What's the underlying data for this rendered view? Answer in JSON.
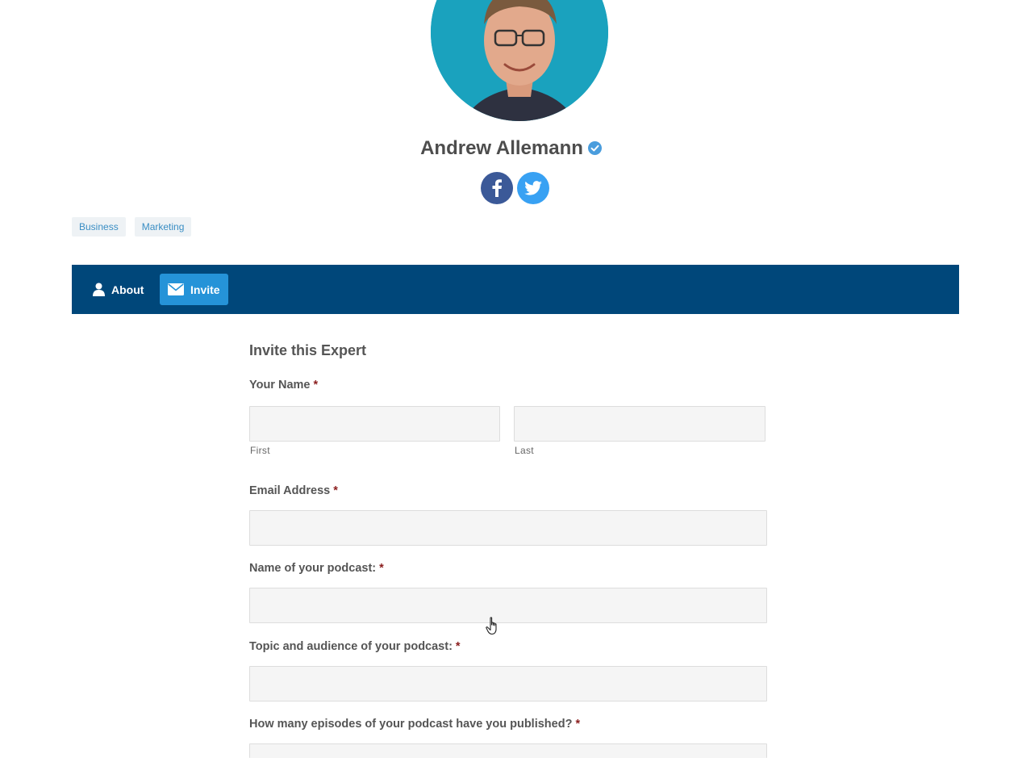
{
  "profile": {
    "name": "Andrew Allemann",
    "verified_icon": "verified-check-icon",
    "social": [
      {
        "name": "facebook",
        "icon": "facebook-icon",
        "color": "#3b5998"
      },
      {
        "name": "twitter",
        "icon": "twitter-icon",
        "color": "#38a1f3"
      }
    ],
    "tags": [
      "Business",
      "Marketing"
    ]
  },
  "tabs": {
    "about_label": "About",
    "invite_label": "Invite",
    "active": "Invite",
    "bar_color": "#00477a",
    "active_color": "#2593d8"
  },
  "form": {
    "title": "Invite this Expert",
    "required_marker": "*",
    "your_name_label": "Your Name",
    "first_sublabel": "First",
    "last_sublabel": "Last",
    "first_value": "",
    "last_value": "",
    "email_label": "Email Address",
    "email_value": "",
    "podcast_name_label": "Name of your podcast:",
    "podcast_name_value": "",
    "topic_label": "Topic and audience of your podcast:",
    "topic_value": "",
    "episodes_label": "How many episodes of your podcast have you published?",
    "episodes_value": ""
  }
}
